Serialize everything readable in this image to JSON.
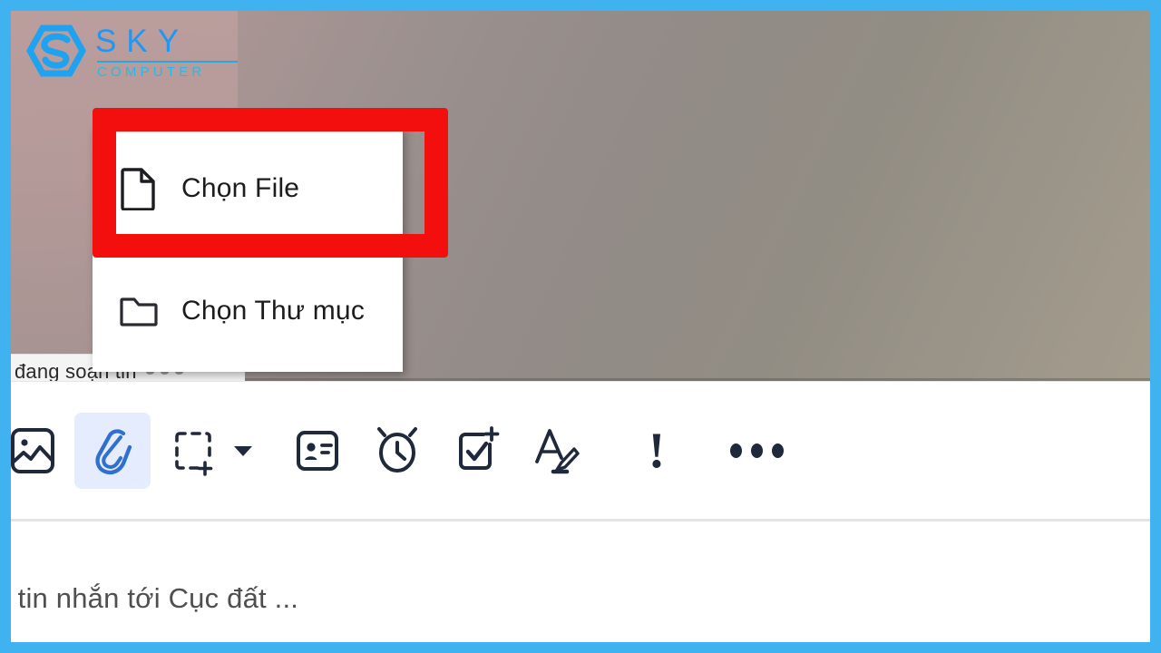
{
  "watermark": {
    "brand_primary": "SKY",
    "brand_secondary": "COMPUTER",
    "logo_icon": "sky-hexagon-s-logo",
    "color": "#2196f3"
  },
  "colors": {
    "frame_blue": "#3fb2ef",
    "highlight_red": "#f40f0f",
    "accent_blue": "#2196f3",
    "toolbar_active_bg": "#e4ecfd",
    "paperclip_blue": "#2f6fd0",
    "icon_dark": "#20283c",
    "background_gradient_start": "#b49a99",
    "background_gradient_end": "#a49d8e"
  },
  "typing_indicator": {
    "text": "đang soạn tin",
    "dots": [
      "dot",
      "dot",
      "dot"
    ]
  },
  "attach_menu": {
    "items": [
      {
        "label": "Chọn File",
        "icon": "file-document-icon",
        "highlighted": true
      },
      {
        "label": "Chọn Thư mục",
        "icon": "folder-icon",
        "highlighted": false
      }
    ]
  },
  "highlight_box": {
    "target": "Chọn File",
    "color": "#f40f0f"
  },
  "toolbar": {
    "buttons": [
      {
        "name": "image-icon",
        "label": "Hình ảnh",
        "active": false
      },
      {
        "name": "paperclip-icon",
        "label": "Đính kèm file",
        "active": true
      },
      {
        "name": "screenshot-icon",
        "label": "Chụp màn hình",
        "active": false
      },
      {
        "name": "contact-card-icon",
        "label": "Danh thiếp",
        "active": false
      },
      {
        "name": "alarm-clock-icon",
        "label": "Nhắc hẹn",
        "active": false
      },
      {
        "name": "task-check-icon",
        "label": "Tạo công việc",
        "active": false
      },
      {
        "name": "text-format-icon",
        "label": "Định dạng",
        "active": false
      },
      {
        "name": "priority-icon",
        "label": "Ưu tiên",
        "active": false
      },
      {
        "name": "more-options-icon",
        "label": "Thêm",
        "active": false
      }
    ],
    "caret_label": "chevron-down-icon"
  },
  "message_preview": {
    "text": ", tin nhắn tới Cục đất ..."
  }
}
